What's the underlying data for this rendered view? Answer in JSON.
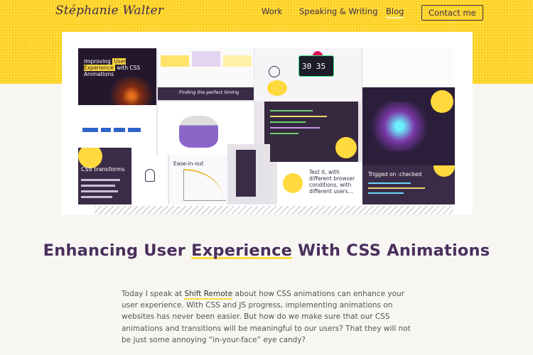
{
  "header": {
    "logo": "Stéphanie Walter",
    "nav": {
      "work": "Work",
      "speaking": "Speaking & Writing",
      "blog": "Blog",
      "contact": "Contact me"
    }
  },
  "hero": {
    "tiles": {
      "t1_prefix": "Improving ",
      "t1_highlight": "User Experience",
      "t1_suffix": " with CSS Animations",
      "t3": "Finding the perfect timing",
      "t4_timer": "30 35",
      "t10": "CSS transforms",
      "t12": "Ease-in-out",
      "t15": "Test it, with different browser conditions, with different users...",
      "t16": "Trigged on :checked"
    }
  },
  "article": {
    "title_before": "Enhancing User ",
    "title_highlight": "Experience",
    "title_after": " With CSS Animations",
    "intro_before_link": "Today I speak at ",
    "intro_link": "Shift Remote",
    "intro_after_link": " about how CSS animations can enhance your user experience. With CSS and JS progress, implementing animations on websites has never been easier. But how do we make sure that our CSS animations and transitions will be meaningful to our users? That they will not be just some annoying “in-your-face” eye candy?"
  },
  "colors": {
    "accent": "#ffd93d",
    "brand_purple": "#4a2f5c",
    "background": "#f7f6f3"
  }
}
